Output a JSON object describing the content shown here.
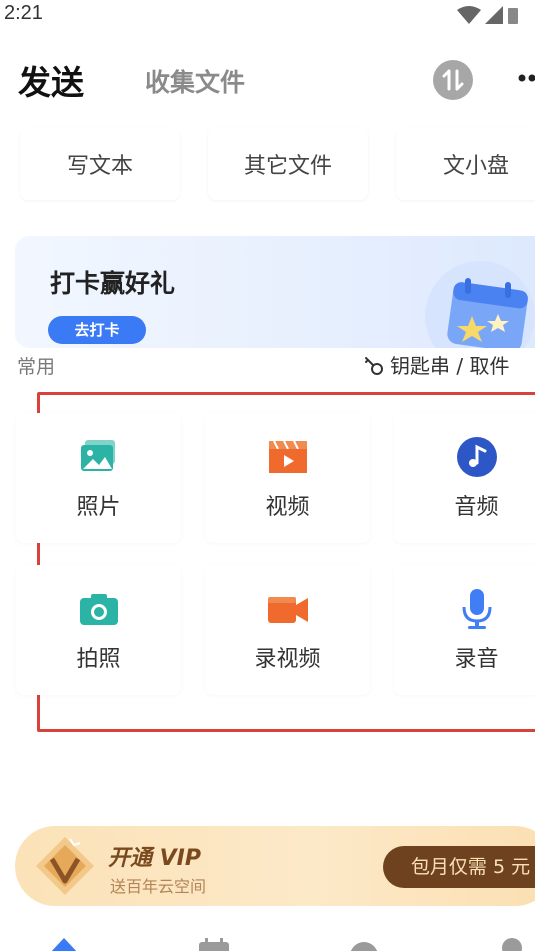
{
  "status_bar": {
    "time": "2:21"
  },
  "header": {
    "tab_send": "发送",
    "tab_collect": "收集文件"
  },
  "tools": [
    {
      "label": "写文本"
    },
    {
      "label": "其它文件"
    },
    {
      "label": "文小盘"
    }
  ],
  "banner": {
    "title": "打卡赢好礼",
    "button": "去打卡"
  },
  "common": {
    "section_label": "常用",
    "key_link": "钥匙串 / 取件"
  },
  "grid": [
    {
      "label": "照片",
      "icon": "photo-icon"
    },
    {
      "label": "视频",
      "icon": "video-icon"
    },
    {
      "label": "音频",
      "icon": "audio-icon"
    },
    {
      "label": "拍照",
      "icon": "camera-icon"
    },
    {
      "label": "录视频",
      "icon": "record-video-icon"
    },
    {
      "label": "录音",
      "icon": "microphone-icon"
    }
  ],
  "vip": {
    "title": "开通 VIP",
    "subtitle": "送百年云空间",
    "button": "包月仅需 5 元"
  },
  "colors": {
    "accent_blue": "#3a7af5",
    "highlight_red": "#d9423a",
    "photo_teal": "#2bb3a5",
    "video_orange": "#f06a2e",
    "mic_blue": "#3f7ef4"
  }
}
